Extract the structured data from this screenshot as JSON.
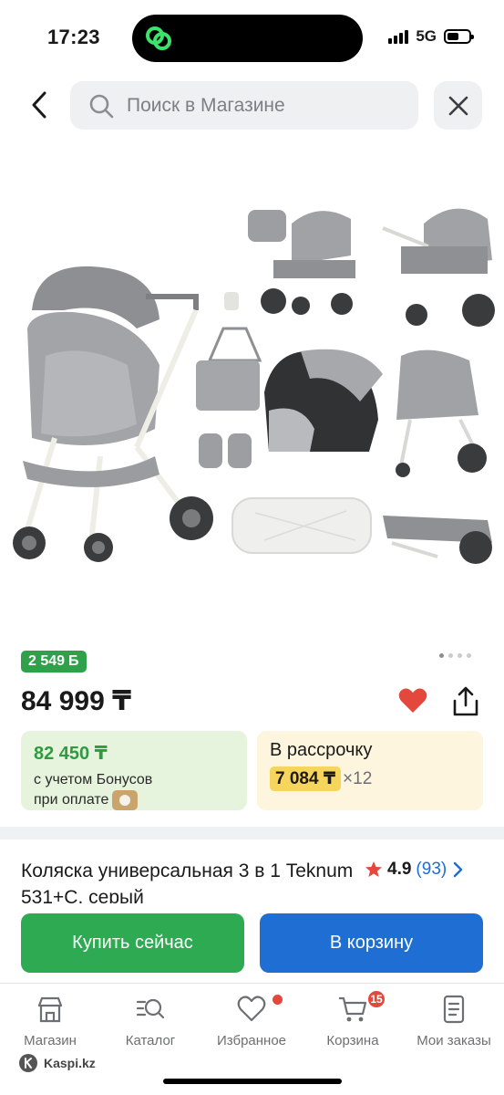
{
  "status_bar": {
    "time": "17:23",
    "network": "5G"
  },
  "search": {
    "placeholder": "Поиск в Магазине"
  },
  "icons": {
    "back": "chevron-left-icon",
    "search": "search-icon",
    "close": "close-icon",
    "favorite": "heart-icon",
    "share": "share-icon",
    "rating_star": "star-icon",
    "rating_arrow": "chevron-right-icon"
  },
  "product": {
    "bonus": "2 549",
    "bonus_currency": "Б",
    "price": "84 999 ₸",
    "favorited": true,
    "image_count": 4,
    "active_image": 1,
    "title": "Коляска универсальная 3 в 1 Teknum 531+C, серый",
    "rating": "4.9",
    "reviews": "(93)"
  },
  "bonus_card": {
    "price": "82 450 ₸",
    "line1": "с учетом Бонусов",
    "line2": "при оплате"
  },
  "installment_card": {
    "title": "В рассрочку",
    "monthly": "7 084 ₸",
    "multiplier": "×12"
  },
  "actions": {
    "buy_now": "Купить сейчас",
    "add_to_cart": "В корзину"
  },
  "tabbar": {
    "items": [
      {
        "label": "Магазин",
        "icon": "store-icon"
      },
      {
        "label": "Каталог",
        "icon": "catalog-icon"
      },
      {
        "label": "Избранное",
        "icon": "heart-icon"
      },
      {
        "label": "Корзина",
        "icon": "cart-icon",
        "badge": "15"
      },
      {
        "label": "Мои заказы",
        "icon": "orders-icon"
      }
    ]
  },
  "footer": {
    "brand": "Kaspi.kz"
  },
  "colors": {
    "green": "#2eab52",
    "blue": "#1f6ed3",
    "red": "#e4483d",
    "bonus_bg": "#e6f4dd",
    "installment_bg": "#fdf5dd",
    "installment_highlight": "#f6d55c"
  }
}
